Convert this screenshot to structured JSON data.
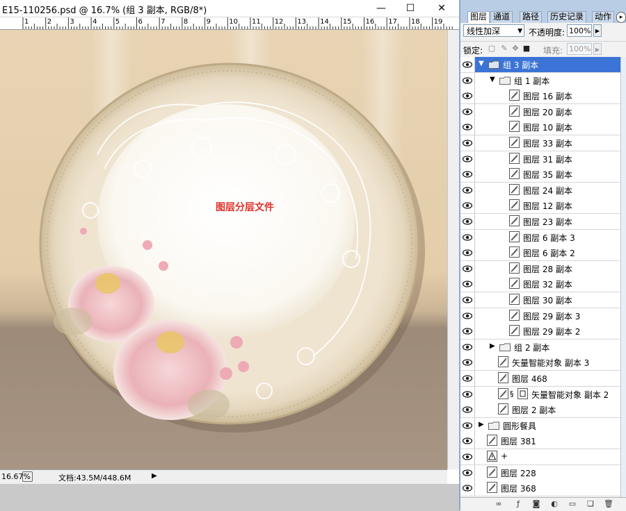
{
  "document": {
    "title": "E15-110256.psd @ 16.7% (组 3 副本, RGB/8*)",
    "minimize": "—",
    "maximize": "☐",
    "close": "✕",
    "ruler_labels": [
      "1",
      "2",
      "3",
      "4",
      "5",
      "6",
      "7",
      "8",
      "9",
      "10",
      "11",
      "12",
      "13",
      "14",
      "15",
      "16",
      "17",
      "18",
      "19"
    ],
    "overlay_text": "图层分层文件",
    "overlay_color": "#e0302a"
  },
  "status": {
    "zoom": "16.67%",
    "doc_info": "文档:43.5M/448.6M",
    "arrow": "▶"
  },
  "panel": {
    "tabs": [
      "图层",
      "通道",
      "路径",
      "历史记录",
      "动作"
    ],
    "active_tab": "图层",
    "menu_button": "▸",
    "blend_mode": "线性加深",
    "opacity_label": "不透明度:",
    "opacity_value": "100%",
    "lock_label": "锁定:",
    "fill_label": "填充:",
    "fill_value": "100%",
    "selection_color": "#3b74d6",
    "layers": [
      {
        "name": "组 3 副本",
        "kind": "group",
        "indent": 0,
        "expanded": true,
        "selected": true
      },
      {
        "name": "组 1 副本",
        "kind": "group",
        "indent": 1,
        "expanded": true
      },
      {
        "name": "图层 16 副本",
        "kind": "pixel",
        "indent": 2
      },
      {
        "name": "图层 20 副本",
        "kind": "pixel",
        "indent": 2
      },
      {
        "name": "图层 10 副本",
        "kind": "pixel",
        "indent": 2
      },
      {
        "name": "图层 33 副本",
        "kind": "pixel",
        "indent": 2
      },
      {
        "name": "图层 31 副本",
        "kind": "pixel",
        "indent": 2
      },
      {
        "name": "图层 35 副本",
        "kind": "pixel",
        "indent": 2
      },
      {
        "name": "图层 24 副本",
        "kind": "pixel",
        "indent": 2
      },
      {
        "name": "图层 12 副本",
        "kind": "pixel",
        "indent": 2
      },
      {
        "name": "图层 23 副本",
        "kind": "pixel",
        "indent": 2
      },
      {
        "name": "图层 6 副本 3",
        "kind": "pixel",
        "indent": 2
      },
      {
        "name": "图层 6 副本 2",
        "kind": "pixel",
        "indent": 2
      },
      {
        "name": "图层 28 副本",
        "kind": "pixel",
        "indent": 2
      },
      {
        "name": "图层 32 副本",
        "kind": "pixel",
        "indent": 2
      },
      {
        "name": "图层 30 副本",
        "kind": "pixel",
        "indent": 2
      },
      {
        "name": "图层 29 副本 3",
        "kind": "pixel",
        "indent": 2
      },
      {
        "name": "图层 29 副本 2",
        "kind": "pixel",
        "indent": 2
      },
      {
        "name": "组 2 副本",
        "kind": "group",
        "indent": 1,
        "expanded": false
      },
      {
        "name": "矢量智能对象 副本 3",
        "kind": "pixel",
        "indent": 1
      },
      {
        "name": "图层 468",
        "kind": "pixel",
        "indent": 1
      },
      {
        "name": "矢量智能对象 副本 2",
        "kind": "masked",
        "indent": 1
      },
      {
        "name": "图层 2 副本",
        "kind": "pixel",
        "indent": 1
      },
      {
        "name": "圆形餐具",
        "kind": "group",
        "indent": 0,
        "expanded": false
      },
      {
        "name": "图层 381",
        "kind": "pixel",
        "indent": 0
      },
      {
        "name": "+",
        "kind": "warning",
        "indent": 0
      },
      {
        "name": "图层 228",
        "kind": "pixel",
        "indent": 0
      },
      {
        "name": "图层 368",
        "kind": "pixel",
        "indent": 0
      }
    ]
  }
}
